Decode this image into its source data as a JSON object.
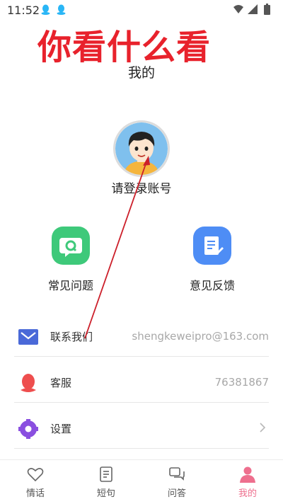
{
  "status_bar": {
    "time": "11:52"
  },
  "watermark": "你看什么看",
  "page": {
    "title": "我的"
  },
  "profile": {
    "login_prompt": "请登录账号"
  },
  "features": [
    {
      "label": "常见问题",
      "icon": "q-chat-icon",
      "color": "#3ec97a"
    },
    {
      "label": "意见反馈",
      "icon": "feedback-edit-icon",
      "color": "#4e8df5"
    }
  ],
  "menu": [
    {
      "label": "联系我们",
      "value": "shengkeweipro@163.com",
      "icon": "mail-icon",
      "color": "#4a69d8"
    },
    {
      "label": "客服",
      "value": "76381867",
      "icon": "qq-icon",
      "color": "#ee4e4e"
    },
    {
      "label": "设置",
      "value": "",
      "icon": "gear-icon",
      "color": "#8a4fe0"
    }
  ],
  "tabs": [
    {
      "label": "情话",
      "icon": "heart-icon",
      "active": false
    },
    {
      "label": "短句",
      "icon": "document-icon",
      "active": false
    },
    {
      "label": "问答",
      "icon": "chat-icon",
      "active": false
    },
    {
      "label": "我的",
      "icon": "person-icon",
      "active": true
    }
  ],
  "colors": {
    "accent": "#ee6f8e",
    "watermark": "#e8222c",
    "annotation_arrow": "#cc1f2a"
  }
}
